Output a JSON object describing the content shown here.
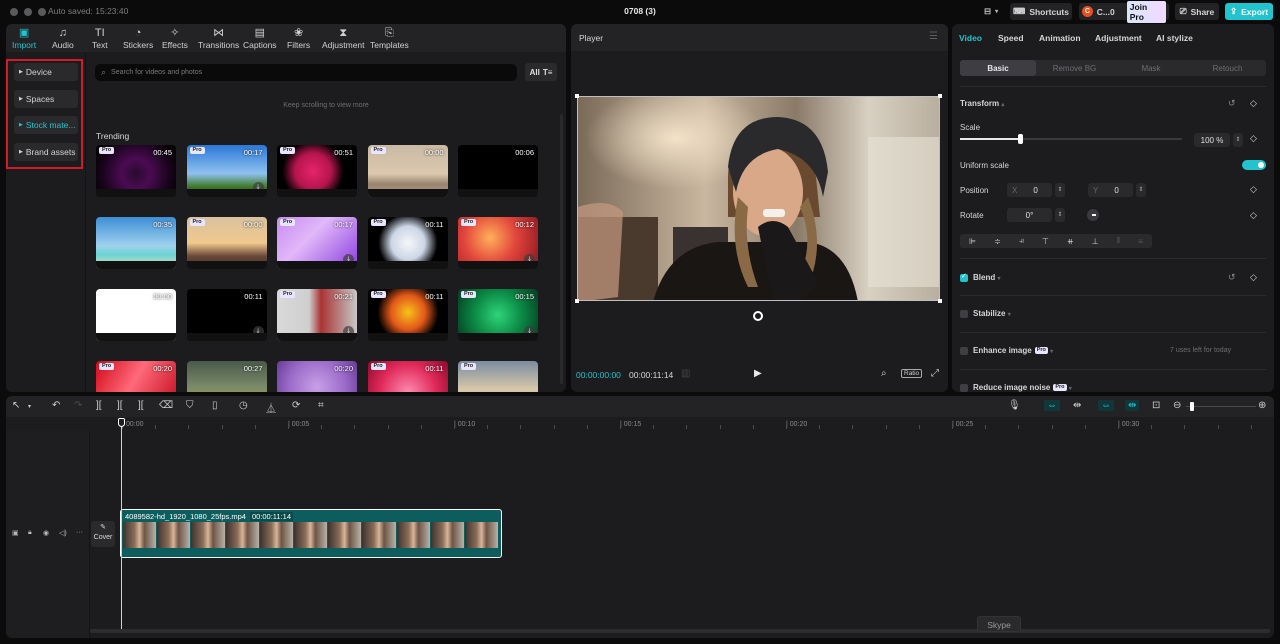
{
  "window": {
    "auto_saved": "Auto saved: 15:23:40",
    "title": "0708 (3)",
    "shortcuts_label": "Shortcuts",
    "account_initial": "C",
    "account_label": "C...0",
    "join_pro_label": "Join Pro",
    "share_label": "Share",
    "export_label": "Export",
    "accent_color": "#21c3cf"
  },
  "media_tabs": [
    {
      "label": "Import",
      "icon": "▣",
      "active": true
    },
    {
      "label": "Audio",
      "icon": "♫"
    },
    {
      "label": "Text",
      "icon": "TI"
    },
    {
      "label": "Stickers",
      "icon": "◔"
    },
    {
      "label": "Effects",
      "icon": "✧"
    },
    {
      "label": "Transitions",
      "icon": "⋈"
    },
    {
      "label": "Captions",
      "icon": "▤"
    },
    {
      "label": "Filters",
      "icon": "❀"
    },
    {
      "label": "Adjustment",
      "icon": "⧗"
    },
    {
      "label": "Templates",
      "icon": "⎘"
    }
  ],
  "side_nav": [
    {
      "label": "Device"
    },
    {
      "label": "Spaces"
    },
    {
      "label": "Stock mate...",
      "active": true
    },
    {
      "label": "Brand assets"
    }
  ],
  "search": {
    "placeholder": "Search for videos and photos",
    "filter_label": "All"
  },
  "keep_scrolling": "Keep scrolling to view more",
  "section_title": "Trending",
  "thumbnails": [
    {
      "pro": true,
      "duration": "00:45",
      "bg": "radial-gradient(circle at 50% 55%,#2a0a2e 0%,#4a0b52 30%,#160418 70%,#000 100%)"
    },
    {
      "pro": true,
      "duration": "00:17",
      "download": true,
      "bg": "linear-gradient(180deg,#2b78d8 0%,#8fc1ef 55%,#3f7a2a 80%,#22401a 100%)"
    },
    {
      "pro": true,
      "duration": "00:51",
      "bg": "radial-gradient(circle at 45% 50%,#e6246a 0%,#b5154d 35%,#000 60%)"
    },
    {
      "pro": true,
      "duration": "00:00",
      "bg": "linear-gradient(180deg,#c9b9a4 0%,#dcc8ae 55%,#9a8470 75%,#b79d85 100%)"
    },
    {
      "duration": "00:06",
      "bg": "#000"
    },
    {
      "duration": "00:35",
      "bg": "linear-gradient(180deg,#3d8ed6 0%,#9fd1ee 55%,#6ad3d2 72%,#e8dcc4 100%)"
    },
    {
      "pro": true,
      "duration": "00:00",
      "bg": "linear-gradient(180deg,#d9c2a0 0%,#f0c88c 50%,#6a4a3a 75%,#3a2a22 100%)"
    },
    {
      "pro": true,
      "duration": "00:17",
      "download": true,
      "bg": "linear-gradient(135deg,#c98af2 0%,#e0b8f8 40%,#8a3ce0 100%)"
    },
    {
      "pro": true,
      "duration": "00:11",
      "bg": "radial-gradient(circle at 50% 50%,#f4f6fa 0%,#cdd6e6 35%,#000 62%)"
    },
    {
      "pro": true,
      "duration": "00:12",
      "download": true,
      "bg": "radial-gradient(circle at 40% 40%,#ffb05a 0%,#e2463c 45%,#8a1420 100%)"
    },
    {
      "duration": "00:00",
      "bg": "#ffffff"
    },
    {
      "duration": "00:11",
      "download": true,
      "bg": "#000"
    },
    {
      "pro": true,
      "duration": "00:21",
      "download": true,
      "bg": "linear-gradient(90deg,#d9d9d9 0%,#cfcfcf 40%,#a33 55%,#c8c8c8 100%)"
    },
    {
      "pro": true,
      "duration": "00:11",
      "bg": "radial-gradient(circle at 50% 45%,#f7c21a 0%,#e2581a 35%,#000 62%)"
    },
    {
      "pro": true,
      "duration": "00:15",
      "download": true,
      "bg": "radial-gradient(circle at 50% 50%,#2fd47a 0%,#0b8a46 50%,#053a20 100%)"
    },
    {
      "pro": true,
      "duration": "00:20",
      "bg": "linear-gradient(120deg,#d10a1a 0%,#ff6a7a 45%,#c0081a 100%)"
    },
    {
      "duration": "00:27",
      "bg": "linear-gradient(180deg,#4a5a4a 0%,#7a8a6a 50%,#c8b02a 100%)"
    },
    {
      "duration": "00:20",
      "bg": "radial-gradient(circle at 50% 50%,#c8a0e8 0%,#9a6ac8 60%,#6a3a98 100%)"
    },
    {
      "pro": true,
      "duration": "00:11",
      "bg": "radial-gradient(circle at 50% 60%,#ff8ab0 0%,#e02a5a 55%,#8a0a2a 100%)"
    },
    {
      "pro": true,
      "duration": "",
      "bg": "linear-gradient(180deg,#7a8ca0 0%,#d8c8a8 55%,#8a9ab0 100%)"
    }
  ],
  "player": {
    "title": "Player",
    "current_time": "00:00:00:00",
    "total_time": "00:00:11:14",
    "ratio_label": "Ratio"
  },
  "props": {
    "tabs": [
      {
        "label": "Video",
        "active": true
      },
      {
        "label": "Speed"
      },
      {
        "label": "Animation"
      },
      {
        "label": "Adjustment"
      },
      {
        "label": "AI stylize"
      }
    ],
    "subtabs": [
      {
        "label": "Basic",
        "active": true
      },
      {
        "label": "Remove BG"
      },
      {
        "label": "Mask"
      },
      {
        "label": "Retouch"
      }
    ],
    "transform_label": "Transform",
    "scale_label": "Scale",
    "scale_value": "100 %",
    "scale_slider_fraction": 0.27,
    "uniform_scale_label": "Uniform scale",
    "uniform_scale_on": true,
    "position_label": "Position",
    "pos_x_label": "X",
    "pos_x": "0",
    "pos_y_label": "Y",
    "pos_y": "0",
    "rotate_label": "Rotate",
    "rotate_value": "0°",
    "blend_label": "Blend",
    "blend_checked": true,
    "stabilize_label": "Stabilize",
    "enhance_label": "Enhance image",
    "enhance_note": "7 uses left for today",
    "noise_label": "Reduce image noise",
    "pro_badge": "Pro"
  },
  "timeline": {
    "ruler_labels": [
      "00:00",
      "00:05",
      "00:10",
      "00:15",
      "00:20",
      "00:25",
      "00:30"
    ],
    "clip_name": "4089582-hd_1920_1080_25fps.mp4",
    "clip_duration": "00:00:11:14",
    "cover_label": "Cover",
    "zoom_fraction": 0.05
  },
  "tooltip": "Skype"
}
